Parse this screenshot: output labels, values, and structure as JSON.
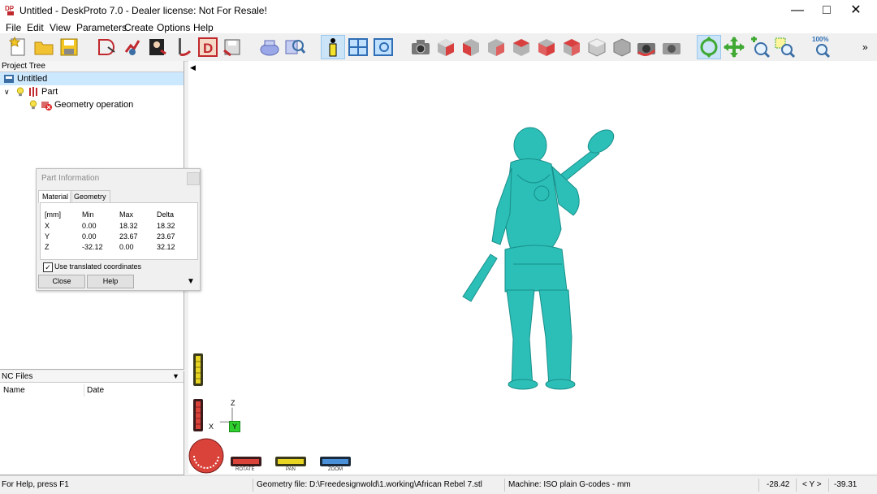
{
  "window": {
    "title": "Untitled - DeskProto 7.0 - Dealer license: Not For Resale!",
    "app_icon_label": "DP"
  },
  "menu": [
    "File",
    "Edit",
    "View",
    "Parameters",
    "Create",
    "Options",
    "Help"
  ],
  "toolbar": {
    "zoom_badge": "100%",
    "more": "»"
  },
  "project_tree": {
    "header": "Project Tree",
    "items": [
      "Untitled",
      "Part",
      "Geometry operation"
    ]
  },
  "part_info": {
    "title": "Part Information",
    "tabs": [
      "Material",
      "Geometry"
    ],
    "columns": [
      "[mm]",
      "Min",
      "Max",
      "Delta"
    ],
    "rows": [
      {
        "axis": "X",
        "min": "0.00",
        "max": "18.32",
        "delta": "18.32"
      },
      {
        "axis": "Y",
        "min": "0.00",
        "max": "23.67",
        "delta": "23.67"
      },
      {
        "axis": "Z",
        "min": "-32.12",
        "max": "0.00",
        "delta": "32.12"
      }
    ],
    "checkbox_label": "Use translated coordinates",
    "checked": true,
    "buttons": [
      "Close",
      "Help"
    ]
  },
  "nc_files": {
    "header": "NC Files",
    "columns": [
      "Name",
      "Date"
    ]
  },
  "viewport": {
    "axis_labels": {
      "z": "Z",
      "x": "X",
      "y": "Y"
    },
    "controls": [
      "ROTATE",
      "PAN",
      "ZOOM"
    ],
    "model_color": "#2bbfb8"
  },
  "status": {
    "help": "For Help, press F1",
    "geometry": "Geometry file: D:\\Freedesignwold\\1.working\\African Rebel 7.stl",
    "machine": "Machine: ISO plain G-codes - mm",
    "coord_left": "-28.42",
    "coord_axis": "< Y >",
    "coord_right": "-39.31"
  }
}
